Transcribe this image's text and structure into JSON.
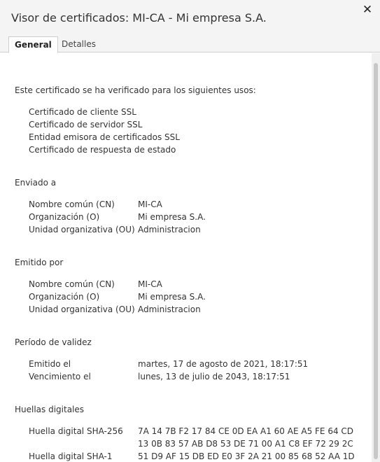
{
  "window": {
    "title": "Visor de certificados: MI-CA - Mi empresa S.A."
  },
  "tabs": [
    {
      "label": "General",
      "active": true
    },
    {
      "label": "Detalles",
      "active": false
    }
  ],
  "usage": {
    "heading": "Este certificado se ha verificado para los siguientes usos:",
    "items": [
      "Certificado de cliente SSL",
      "Certificado de servidor SSL",
      "Entidad emisora de certificados SSL",
      "Certificado de respuesta de estado"
    ]
  },
  "issued_to": {
    "heading": "Enviado a",
    "rows": [
      {
        "label": "Nombre común (CN)",
        "value": "MI-CA"
      },
      {
        "label": "Organización (O)",
        "value": "Mi empresa S.A."
      },
      {
        "label": "Unidad organizativa (OU)",
        "value": "Administracion"
      }
    ]
  },
  "issued_by": {
    "heading": "Emitido por",
    "rows": [
      {
        "label": "Nombre común (CN)",
        "value": "MI-CA"
      },
      {
        "label": "Organización (O)",
        "value": "Mi empresa S.A."
      },
      {
        "label": "Unidad organizativa (OU)",
        "value": "Administracion"
      }
    ]
  },
  "validity": {
    "heading": "Período de validez",
    "rows": [
      {
        "label": "Emitido el",
        "value": "martes, 17 de agosto de 2021, 18:17:51"
      },
      {
        "label": "Vencimiento el",
        "value": "lunes, 13 de julio de 2043, 18:17:51"
      }
    ]
  },
  "fingerprints": {
    "heading": "Huellas digitales",
    "sha256": {
      "label": "Huella digital SHA-256",
      "line1": "7A 14 7B F2 17 84 CE 0D EA A1 60 AE A5 FE 64 CD",
      "line2": "13 0B 83 57 AB D8 53 DE 71 00 A1 C8 EF 72 29 2C"
    },
    "sha1": {
      "label": "Huella digital SHA-1",
      "value": "51 D9 AF 15 DB ED E0 3F 2A 21 00 85 68 52 AA 1D"
    }
  },
  "icons": {
    "close": "close-icon"
  }
}
